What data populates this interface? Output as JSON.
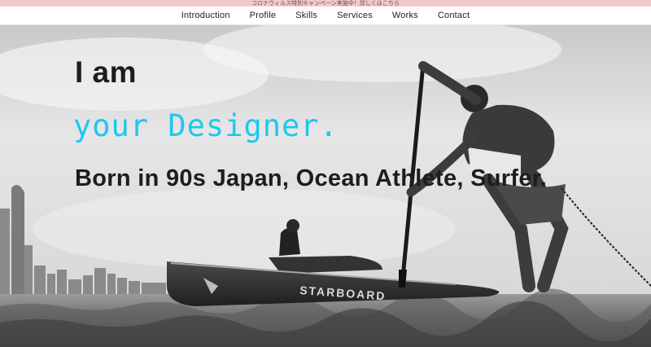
{
  "announcement": {
    "text": "コロナウィルス特別キャンペーン実施中！詳しくはこちら"
  },
  "nav": {
    "items": [
      {
        "label": "Introduction"
      },
      {
        "label": "Profile"
      },
      {
        "label": "Skills"
      },
      {
        "label": "Services"
      },
      {
        "label": "Works"
      },
      {
        "label": "Contact"
      }
    ]
  },
  "hero": {
    "line1": "I am",
    "line2": "your Designer.",
    "line3": "Born in 90s Japan, Ocean Athlete, Surfer.",
    "board_brand": "STARBOARD",
    "accent_color": "#1ec7f0",
    "text_color": "#1d1d1d",
    "announce_bg": "#f4c9cc"
  }
}
